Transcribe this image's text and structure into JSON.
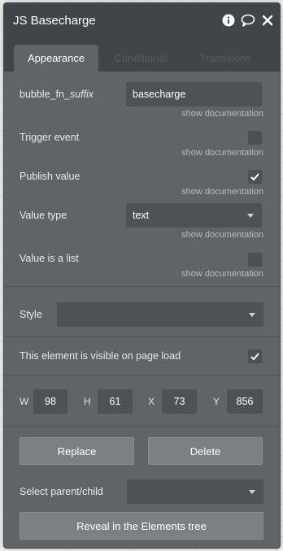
{
  "window": {
    "title": "JS Basecharge"
  },
  "tabs": [
    {
      "label": "Appearance"
    },
    {
      "label": "Conditional"
    },
    {
      "label": "Transitions"
    }
  ],
  "fields": {
    "suffix": {
      "label_prefix": "bubble_fn_",
      "label_italic": "suffix",
      "value": "basecharge",
      "doc": "show documentation"
    },
    "trigger": {
      "label": "Trigger event",
      "checked": false,
      "doc": "show documentation"
    },
    "publish": {
      "label": "Publish value",
      "checked": true,
      "doc": "show documentation"
    },
    "value_type": {
      "label": "Value type",
      "value": "text",
      "doc": "show documentation"
    },
    "is_list": {
      "label": "Value is a list",
      "checked": false,
      "doc": "show documentation"
    }
  },
  "style": {
    "label": "Style",
    "value": ""
  },
  "visible": {
    "label": "This element is visible on page load",
    "checked": true
  },
  "dimensions": {
    "w": {
      "label": "W",
      "value": "98"
    },
    "h": {
      "label": "H",
      "value": "61"
    },
    "x": {
      "label": "X",
      "value": "73"
    },
    "y": {
      "label": "Y",
      "value": "856"
    }
  },
  "actions": {
    "replace": "Replace",
    "delete": "Delete"
  },
  "parent_child": {
    "label": "Select parent/child",
    "value": ""
  },
  "reveal": {
    "label": "Reveal in the Elements tree"
  },
  "icons": {
    "info": "info-icon",
    "comment": "comment-icon",
    "close": "close-icon",
    "check": "check-icon"
  },
  "colors": {
    "panel": "#5e6468",
    "titlebar": "#40454a",
    "input": "#4d5256",
    "button": "#7a8084"
  }
}
